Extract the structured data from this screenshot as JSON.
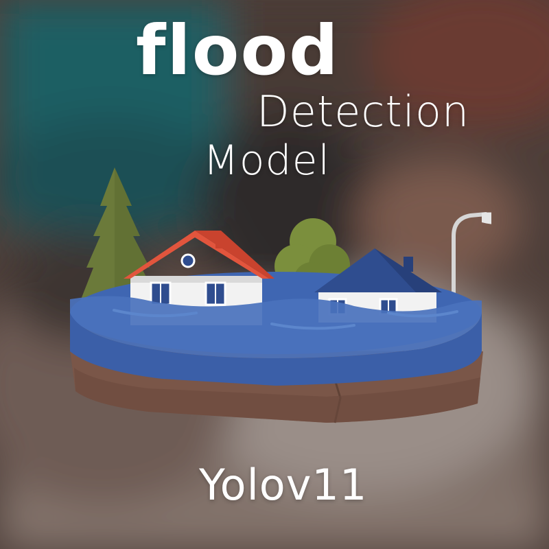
{
  "poster": {
    "title_line1": "flood",
    "title_line2": "Detection",
    "title_line3": "Model",
    "caption": "Yolov11"
  },
  "colors": {
    "text": "#ffffff",
    "water": "#3f66b2",
    "soil": "#7a5648",
    "tree": "#6b7a3a",
    "bush": "#7b8f3d",
    "roof_red": "#e2553d",
    "roof_blue": "#2f4d8f",
    "wall": "#f2f2f2"
  },
  "icons": [
    "floating-island-illustration",
    "pine-tree-icon",
    "bush-icon",
    "house-icon",
    "street-lamp-icon"
  ]
}
